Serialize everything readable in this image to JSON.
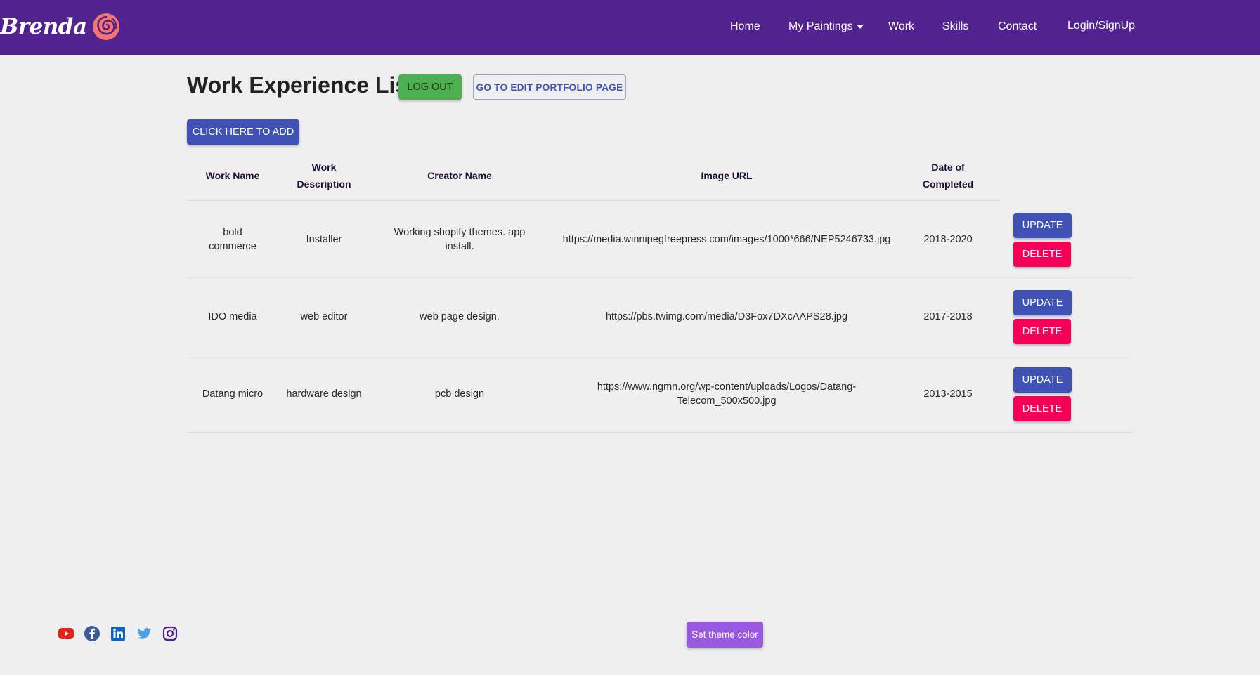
{
  "navbar": {
    "brand": "Brenda",
    "links": {
      "home": "Home",
      "paintings": "My Paintings",
      "work": "Work",
      "skills": "Skills",
      "contact": "Contact",
      "login": "Login/SignUp"
    }
  },
  "header": {
    "title": "Work Experience List",
    "logout_label": "LOG OUT",
    "edit_portfolio_label": "GO TO EDIT PORTFOLIO PAGE",
    "add_label": "CLICK HERE TO ADD"
  },
  "table": {
    "columns": {
      "work_name": "Work Name",
      "work_description": "Work Description",
      "creator_name": "Creator Name",
      "image_url": "Image URL",
      "date_completed": "Date of Completed"
    },
    "rows": [
      {
        "work_name": "bold commerce",
        "work_description": "Installer",
        "creator_name": "Working shopify themes. app install.",
        "image_url": "https://media.winnipegfreepress.com/images/1000*666/NEP5246733.jpg",
        "date_completed": "2018-2020"
      },
      {
        "work_name": "IDO media",
        "work_description": "web editor",
        "creator_name": "web page design.",
        "image_url": "https://pbs.twimg.com/media/D3Fox7DXcAAPS28.jpg",
        "date_completed": "2017-2018"
      },
      {
        "work_name": "Datang micro",
        "work_description": "hardware design",
        "creator_name": "pcb design",
        "image_url": "https://www.ngmn.org/wp-content/uploads/Logos/Datang-Telecom_500x500.jpg",
        "date_completed": "2013-2015"
      }
    ],
    "update_label": "UPDATE",
    "delete_label": "DELETE"
  },
  "footer": {
    "theme_label": "Set theme color",
    "socials": [
      "youtube-icon",
      "facebook-icon",
      "linkedin-icon",
      "twitter-icon",
      "instagram-icon"
    ]
  },
  "colors": {
    "navbar": "#51238f",
    "primary": "#3f51b5",
    "logout": "#4caf50",
    "delete": "#f50057",
    "theme": "#9a5ae0"
  }
}
